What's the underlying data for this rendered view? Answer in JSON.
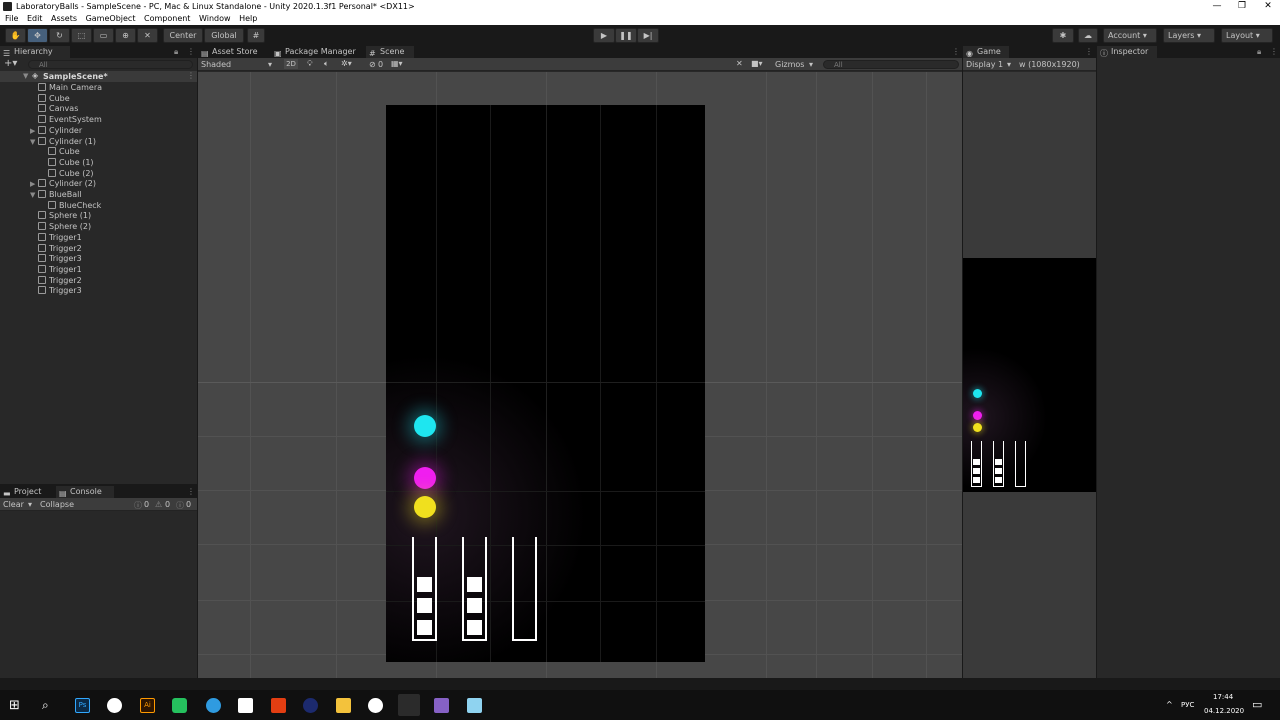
{
  "window": {
    "title": "LaboratoryBalls - SampleScene - PC, Mac & Linux Standalone - Unity 2020.1.3f1 Personal* <DX11>",
    "minimize": "—",
    "maximize": "❐",
    "close": "✕"
  },
  "menu": [
    "File",
    "Edit",
    "Assets",
    "GameObject",
    "Component",
    "Window",
    "Help"
  ],
  "toolbar": {
    "center": "Center",
    "global": "Global",
    "account": "Account",
    "layers": "Layers",
    "layout": "Layout"
  },
  "hierarchy": {
    "tab": "Hierarchy",
    "search_placeholder": "All",
    "scene": "SampleScene*",
    "items": [
      {
        "label": "Main Camera"
      },
      {
        "label": "Cube"
      },
      {
        "label": "Canvas"
      },
      {
        "label": "EventSystem"
      },
      {
        "label": "Cylinder"
      },
      {
        "label": "Cylinder (1)"
      },
      {
        "label": "Cube"
      },
      {
        "label": "Cube (1)"
      },
      {
        "label": "Cube (2)"
      },
      {
        "label": "Cylinder (2)"
      },
      {
        "label": "BlueBall"
      },
      {
        "label": "BlueCheck"
      },
      {
        "label": "Sphere (1)"
      },
      {
        "label": "Sphere (2)"
      },
      {
        "label": "Trigger1"
      },
      {
        "label": "Trigger2"
      },
      {
        "label": "Trigger3"
      },
      {
        "label": "Trigger1"
      },
      {
        "label": "Trigger2"
      },
      {
        "label": "Trigger3"
      }
    ]
  },
  "project_tabs": {
    "project": "Project",
    "console": "Console",
    "clear": "Clear",
    "collapse": "Collapse",
    "count_a": "0",
    "count_b": "0",
    "count_c": "0"
  },
  "scene_tabs": {
    "asset_store": "Asset Store",
    "package_manager": "Package Manager",
    "scene": "Scene"
  },
  "scene_bar": {
    "shading": "Shaded",
    "two_d": "2D",
    "hidden_count": "0",
    "gizmos": "Gizmos",
    "search_placeholder": "All"
  },
  "game": {
    "tab": "Game",
    "display": "Display 1",
    "resolution": "w (1080x1920)"
  },
  "inspector": {
    "tab": "Inspector"
  },
  "taskbar": {
    "lang": "РУС",
    "time": "17:44",
    "date": "04.12.2020"
  },
  "colors": {
    "cyan": "#1ee6f0",
    "magenta": "#f01ef0",
    "yellow": "#f0e01e",
    "unity_bg": "#191919",
    "panel": "#282828",
    "scene_bg": "#474747"
  }
}
